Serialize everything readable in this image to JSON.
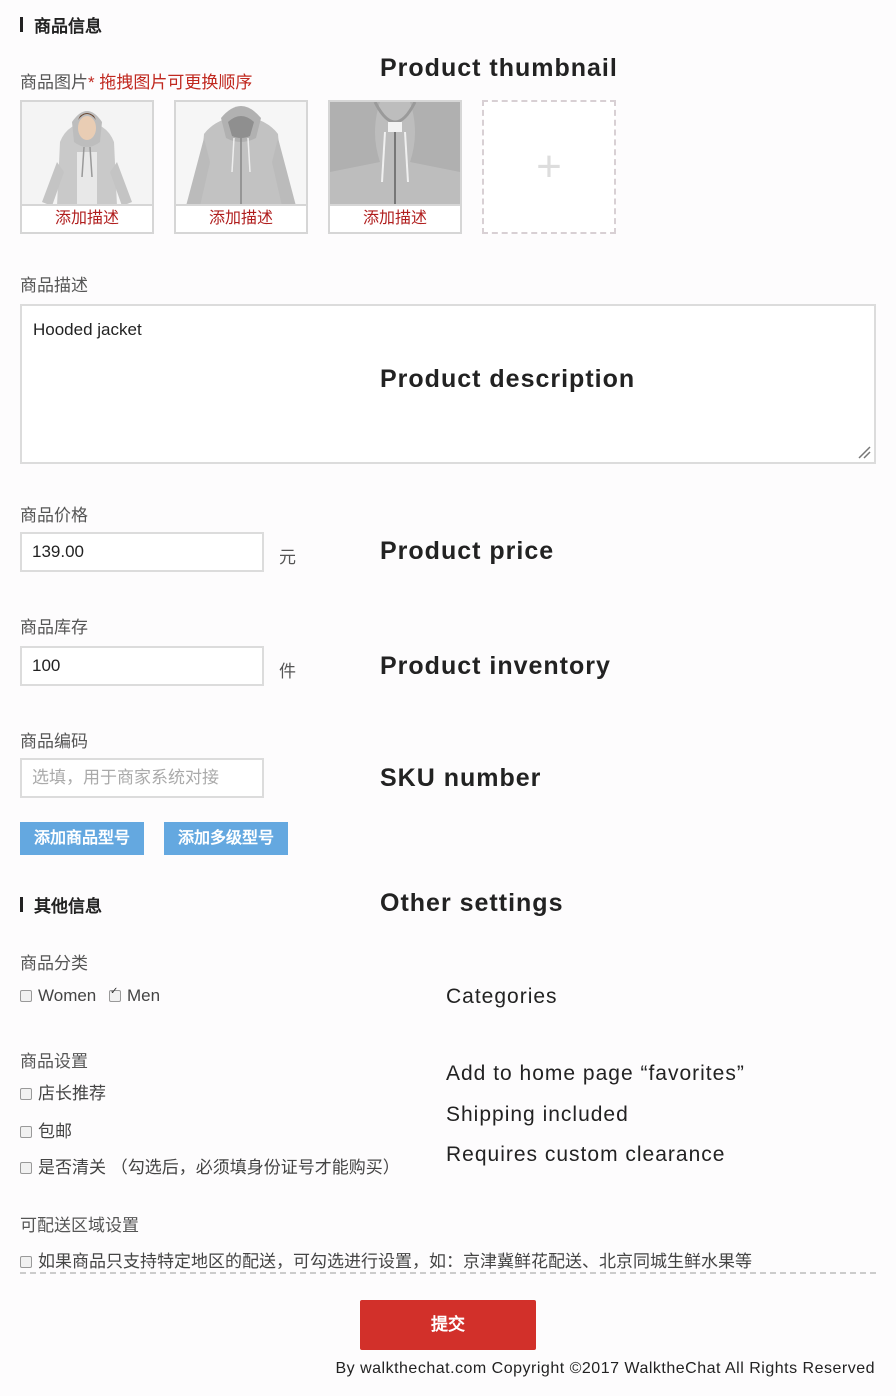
{
  "section1": {
    "title": "商品信息"
  },
  "images": {
    "label": "商品图片",
    "hint": "* 拖拽图片可更换顺序",
    "caption": "添加描述",
    "add_symbol": "+",
    "count": 3
  },
  "description": {
    "label": "商品描述",
    "value": "Hooded jacket"
  },
  "price": {
    "label": "商品价格",
    "value": "139.00",
    "unit": "元"
  },
  "inventory": {
    "label": "商品库存",
    "value": "100",
    "unit": "件"
  },
  "sku": {
    "label": "商品编码",
    "placeholder": "选填，用于商家系统对接"
  },
  "buttons": {
    "add_model": "添加商品型号",
    "add_multi_model": "添加多级型号"
  },
  "section2": {
    "title": "其他信息"
  },
  "category": {
    "label": "商品分类",
    "options": [
      {
        "label": "Women",
        "checked": false
      },
      {
        "label": "Men",
        "checked": true
      }
    ]
  },
  "settings": {
    "label": "商品设置",
    "options": [
      {
        "label": "店长推荐",
        "checked": false
      },
      {
        "label": "包邮",
        "checked": false
      },
      {
        "label": "是否清关 （勾选后，必须填身份证号才能购买）",
        "checked": false
      }
    ]
  },
  "delivery": {
    "label": "可配送区域设置",
    "option": "如果商品只支持特定地区的配送，可勾选进行设置，如：京津冀鲜花配送、北京同城生鲜水果等"
  },
  "submit_label": "提交",
  "annotations": {
    "thumbnail": "Product thumbnail",
    "description": "Product description",
    "price": "Product price",
    "inventory": "Product inventory",
    "sku": "SKU number",
    "other": "Other settings",
    "categories": "Categories",
    "favorites": "Add to home page “favorites”",
    "shipping": "Shipping included",
    "customs": "Requires custom clearance"
  },
  "footer": "By walkthechat.com Copyright ©2017 WalktheChat All Rights Reserved"
}
